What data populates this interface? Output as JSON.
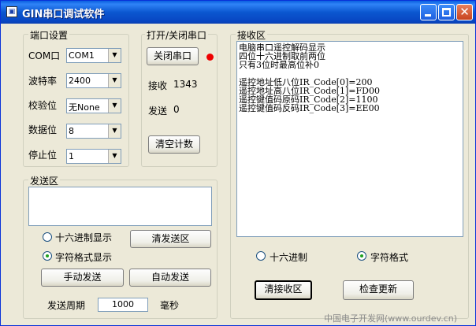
{
  "window": {
    "title": "GIN串口调试软件",
    "app_icon": "app-icon"
  },
  "port_settings": {
    "title": "端口设置",
    "rows": [
      {
        "label": "COM口",
        "value": "COM1"
      },
      {
        "label": "波特率",
        "value": "2400"
      },
      {
        "label": "校验位",
        "value": "无None"
      },
      {
        "label": "数据位",
        "value": "8"
      },
      {
        "label": "停止位",
        "value": "1"
      }
    ]
  },
  "open_close": {
    "title": "打开/关闭串口",
    "toggle_label": "关闭串口",
    "led_color": "#e00000",
    "receive_label": "接收",
    "receive_count": "1343",
    "send_label": "发送",
    "send_count": "0",
    "clear_count_label": "清空计数"
  },
  "send_area": {
    "title": "发送区",
    "text": "",
    "radio_hex": "十六进制显示",
    "radio_char": "字符格式显示",
    "selected": "char",
    "clear_send_label": "清发送区",
    "manual_send_label": "手动发送",
    "auto_send_label": "自动发送",
    "period_label": "发送周期",
    "period_value": "1000",
    "period_unit": "毫秒"
  },
  "receive_area": {
    "title": "接收区",
    "lines": [
      "电脑串口遥控解码显示",
      "四位十六进制取前两位",
      "只有3位时最高位补0",
      "",
      "遥控地址低八位IR_Code[0]=200",
      "遥控地址高八位IR_Code[1]=FD00",
      "遥控键值码原码IR_Code[2]=1100",
      "遥控键值码反码IR_Code[3]=EE00"
    ],
    "radio_hex": "十六进制",
    "radio_char": "字符格式",
    "selected": "char",
    "clear_recv_label": "清接收区",
    "check_update_label": "检查更新"
  },
  "watermark": "中国电子开发网(www.ourdev.cn)"
}
